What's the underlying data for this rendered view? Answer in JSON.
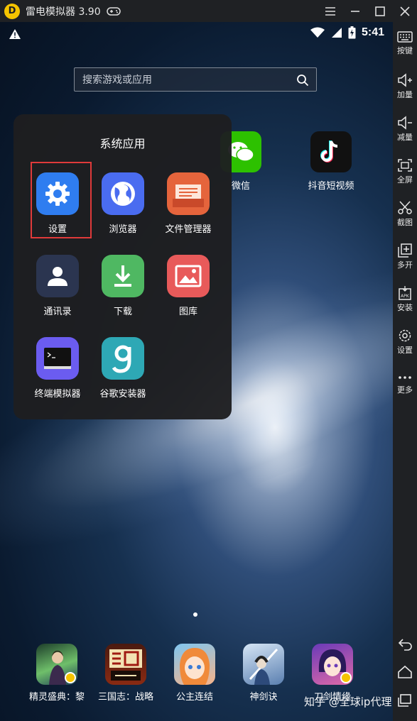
{
  "window": {
    "title": "雷电模拟器 3.90",
    "logo_letter": "D",
    "controls": [
      "menu-icon",
      "minimize-icon",
      "maximize-icon",
      "close-icon"
    ]
  },
  "status": {
    "time": "5:41"
  },
  "search": {
    "placeholder": "搜索游戏或应用"
  },
  "desktop_apps": [
    {
      "label": "微信",
      "icon": "wechat-icon",
      "color": "#2dc100"
    },
    {
      "label": "抖音短视频",
      "icon": "tiktok-icon",
      "color": "#111111"
    }
  ],
  "folder": {
    "title": "系统应用",
    "apps": [
      {
        "label": "设置",
        "icon": "settings-gear-icon",
        "color": "#2f7df0"
      },
      {
        "label": "浏览器",
        "icon": "browser-globe-icon",
        "color": "#4a6cf0"
      },
      {
        "label": "文件管理器",
        "icon": "file-manager-icon",
        "color": "#e5643c"
      },
      {
        "label": "通讯录",
        "icon": "contacts-icon",
        "color": "#2b3550"
      },
      {
        "label": "下载",
        "icon": "download-icon",
        "color": "#4fb862"
      },
      {
        "label": "图库",
        "icon": "gallery-icon",
        "color": "#e85a5a"
      },
      {
        "label": "终端模拟器",
        "icon": "terminal-icon",
        "color": "#6b5cf0"
      },
      {
        "label": "谷歌安装器",
        "icon": "google-installer-icon",
        "color": "#2ea8b5"
      }
    ]
  },
  "dock": [
    {
      "label": "精灵盛典：黎",
      "icon": "game-elf-icon"
    },
    {
      "label": "三国志：战略",
      "icon": "game-sanguo-icon"
    },
    {
      "label": "公主连结",
      "icon": "game-princess-icon"
    },
    {
      "label": "神剑诀",
      "icon": "game-sword-icon"
    },
    {
      "label": "刀剑情缘",
      "icon": "game-blade-icon"
    }
  ],
  "watermark": "知乎 @全球ip代理",
  "toolbar": [
    {
      "label": "按键",
      "icon": "keyboard-icon"
    },
    {
      "label": "加量",
      "icon": "volume-up-icon"
    },
    {
      "label": "减量",
      "icon": "volume-down-icon"
    },
    {
      "label": "全屏",
      "icon": "fullscreen-icon"
    },
    {
      "label": "截图",
      "icon": "scissors-icon"
    },
    {
      "label": "多开",
      "icon": "multi-instance-icon"
    },
    {
      "label": "安装",
      "icon": "apk-install-icon"
    },
    {
      "label": "设置",
      "icon": "settings-icon"
    },
    {
      "label": "更多",
      "icon": "more-dots-icon"
    }
  ],
  "nav": [
    "back-icon",
    "home-icon",
    "recent-apps-icon"
  ],
  "colors": {
    "highlight": "#e03a3a",
    "accent": "#f5c400",
    "chrome": "#1f2124"
  }
}
